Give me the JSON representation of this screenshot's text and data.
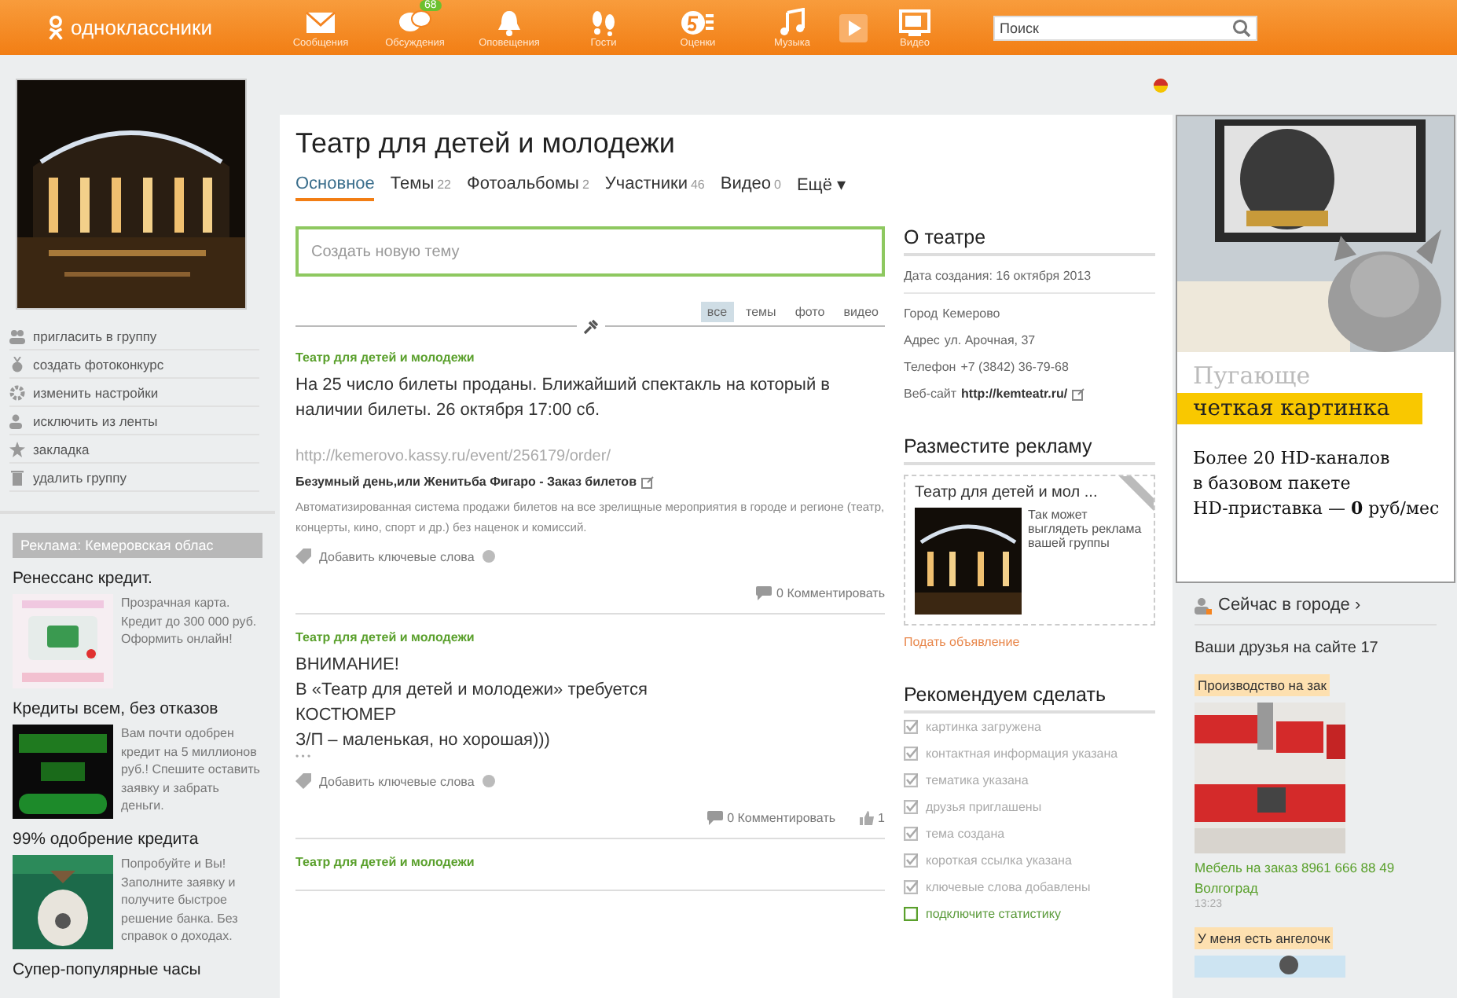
{
  "top_bar": {
    "logo": "одноклассники",
    "nav": [
      {
        "label": "Сообщения"
      },
      {
        "label": "Обсуждения",
        "badge": "68"
      },
      {
        "label": "Оповещения"
      },
      {
        "label": "Гости"
      },
      {
        "label": "Оценки"
      },
      {
        "label": "Музыка"
      },
      {
        "label": "Видео"
      }
    ],
    "search": {
      "placeholder": "Поиск"
    }
  },
  "left": {
    "menu": [
      {
        "label": "пригласить в группу"
      },
      {
        "label": "создать фотоконкурс"
      },
      {
        "label": "изменить настройки"
      },
      {
        "label": "исключить из ленты"
      },
      {
        "label": "закладка"
      },
      {
        "label": "удалить группу"
      }
    ],
    "ads_header": "Реклама: Кемеровская облас",
    "ads": [
      {
        "title": "Ренессанс кредит.",
        "text": "Прозрачная карта. Кредит до 300 000 руб. Оформить онлайн!"
      },
      {
        "title": "Кредиты всем, без отказов",
        "text": "Вам почти одобрен кредит на 5 миллионов руб.! Спешите оставить заявку и забрать деньги."
      },
      {
        "title": "99% одобрение кредита",
        "text": "Попробуйте и Вы! Заполните заявку и получите быстрое решение банка. Без справок о доходах."
      },
      {
        "title": "Супер-популярные часы"
      }
    ]
  },
  "group": {
    "title": "Театр для детей и молодежи",
    "tabs": [
      {
        "label": "Основное",
        "selected": true
      },
      {
        "label": "Темы",
        "count": "22",
        "selected": false
      },
      {
        "label": "Фотоальбомы",
        "count": "2",
        "selected": false
      },
      {
        "label": "Участники",
        "count": "46",
        "selected": false
      },
      {
        "label": "Видео",
        "count": "0",
        "selected": false
      },
      {
        "label": "Ещё ▾",
        "selected": false
      }
    ]
  },
  "new_topic": {
    "placeholder": "Создать новую тему"
  },
  "filters": [
    {
      "label": "все",
      "selected": true
    },
    {
      "label": "темы",
      "selected": false
    },
    {
      "label": "фото",
      "selected": false
    },
    {
      "label": "видео",
      "selected": false
    }
  ],
  "posts": [
    {
      "author": "Театр для детей и молодежи",
      "lines": [
        "На 25 число билеты проданы. Ближайший спектакль на который в наличии билеты. 26 октября 17:00 сб."
      ],
      "url": "http://kemerovo.kassy.ru/event/256179/order/",
      "link_title": "Безумный день,или Женитьба Фигаро - Заказ билетов",
      "link_text": "Автоматизированная система продажи билетов на все зрелищные мероприятия в городе и регионе (театр, концерты, кино, спорт и др.) без наценок и комиссий.",
      "keywords": "Добавить ключевые слова",
      "comments": "0 Комментировать"
    },
    {
      "author": "Театр для детей и молодежи",
      "lines": [
        "ВНИМАНИЕ!",
        "В «Театр для детей и молодежи» требуется",
        "КОСТЮМЕР",
        "З/П – маленькая, но хорошая)))"
      ],
      "more": "• • •",
      "keywords": "Добавить ключевые слова",
      "comments": "0 Комментировать",
      "likes": "1"
    },
    {
      "author": "Театр для детей и молодежи"
    }
  ],
  "about": {
    "title": "О театре",
    "created": "Дата создания: 16 октября 2013",
    "rows": [
      {
        "label": "Город",
        "value": "Кемерово"
      },
      {
        "label": "Адрес",
        "value": "ул. Арочная, 37"
      },
      {
        "label": "Телефон",
        "value": "+7 (3842) 36-79-68"
      },
      {
        "label": "Веб-сайт",
        "value": "http://kemteatr.ru/",
        "kind": "link"
      }
    ]
  },
  "promo": {
    "title": "Разместите рекламу",
    "card_title": "Театр для детей и мол ...",
    "card_text": "Так может выглядеть реклама вашей группы",
    "action": "Подать объявление"
  },
  "todo": {
    "title": "Рекомендуем сделать",
    "items": [
      {
        "label": "картинка загружена",
        "checked": true
      },
      {
        "label": "контактная информация указана",
        "checked": true
      },
      {
        "label": "тематика указана",
        "checked": true
      },
      {
        "label": "друзья приглашены",
        "checked": true
      },
      {
        "label": "тема создана",
        "checked": true
      },
      {
        "label": "короткая ссылка указана",
        "checked": true
      },
      {
        "label": "ключевые слова добавлены",
        "checked": true
      },
      {
        "label": "подключите статистику",
        "checked": false
      }
    ]
  },
  "banner": {
    "line1": "Пугающе",
    "line2": "четкая картинка",
    "line3": "Более 20 HD-каналов",
    "line4": "в базовом пакете",
    "line5": "HD-приставка — **0** руб/мес"
  },
  "city": {
    "title": "Сейчас в городе ›",
    "friends": "Ваши друзья на сайте 17",
    "items": [
      {
        "tag": "Производство на зак",
        "caption": "Мебель на заказ 8961 666 88 49 Волгоград",
        "time": "13:23"
      },
      {
        "tag": "У меня есть ангелочк"
      }
    ]
  }
}
